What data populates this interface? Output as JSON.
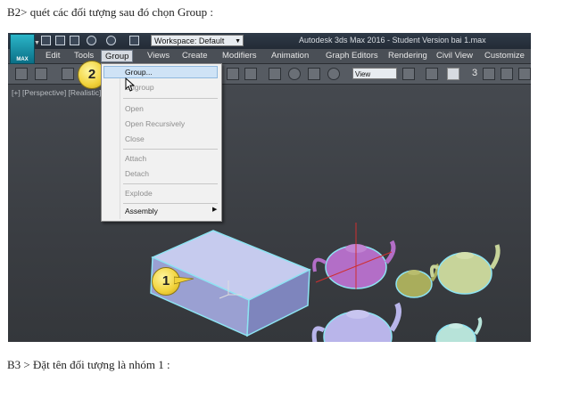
{
  "doc": {
    "line1": "B2> quét các đối tượng sau đó chọn Group :",
    "line2": "B3 > Đặt tên đối tượng là nhóm 1 :"
  },
  "app": {
    "logo_text": "MAX",
    "workspace_label": "Workspace: Default",
    "title": "Autodesk 3ds Max 2016 - Student Version    bai 1.max"
  },
  "menubar": {
    "items": [
      "Edit",
      "Tools",
      "Group",
      "Views",
      "Create",
      "Modifiers",
      "Animation",
      "Graph Editors",
      "Rendering",
      "Civil View",
      "Customize"
    ],
    "active": "Group"
  },
  "toolbar": {
    "view_select": "View",
    "snap_number": "3"
  },
  "viewport": {
    "label": "[+] [Perspective] [Realistic]"
  },
  "group_menu": {
    "items": [
      {
        "label": "Group...",
        "enabled": true,
        "highlighted": true
      },
      {
        "label": "Ungroup",
        "enabled": false
      },
      {
        "label": "Open",
        "enabled": false
      },
      {
        "label": "Open Recursively",
        "enabled": false
      },
      {
        "label": "Close",
        "enabled": false
      },
      {
        "label": "Attach",
        "enabled": false
      },
      {
        "label": "Detach",
        "enabled": false
      },
      {
        "label": "Explode",
        "enabled": false
      },
      {
        "label": "Assembly",
        "enabled": true,
        "submenu": true
      }
    ]
  },
  "callouts": {
    "first": "1",
    "second": "2"
  },
  "colors": {
    "box": "#a9afdc",
    "teapot_magenta": "#b36ec7",
    "teapot_olive": "#a9ad5c",
    "teapot_green": "#c7d49a",
    "teapot_lilac": "#b9b5ea",
    "teapot_mint": "#b7e3d9",
    "selection_outline": "#8de3f2",
    "callout": "#f1d23a"
  }
}
